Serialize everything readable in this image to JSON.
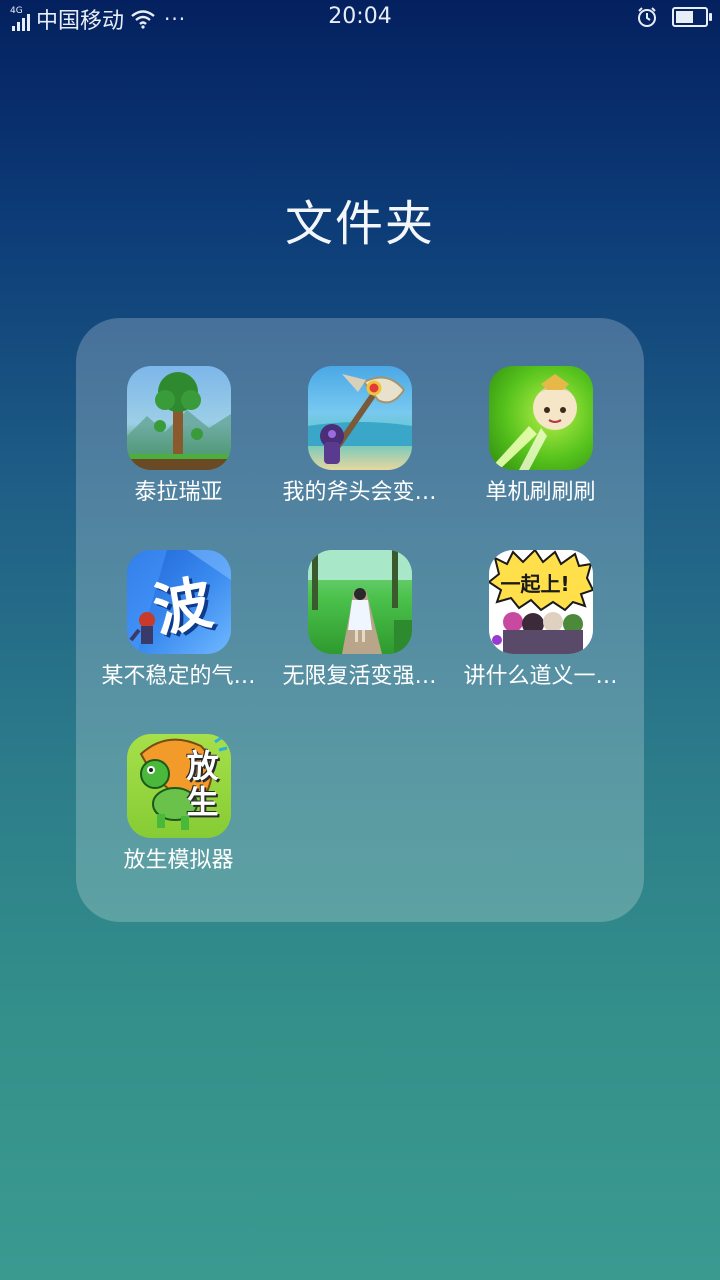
{
  "status_bar": {
    "network": "4G",
    "carrier": "中国移动",
    "more": "···",
    "time": "20:04",
    "battery_level": 0.62
  },
  "folder": {
    "title": "文件夹",
    "apps": [
      {
        "label": "泰拉瑞亚",
        "icon": "terraria-tree-icon"
      },
      {
        "label": "我的斧头会变…",
        "icon": "axe-icon"
      },
      {
        "label": "单机刷刷刷",
        "icon": "hero-sword-icon"
      },
      {
        "label": "某不稳定的气…",
        "icon": "wave-character-icon",
        "icon_text": "波"
      },
      {
        "label": "无限复活变强…",
        "icon": "forest-path-girl-icon"
      },
      {
        "label": "讲什么道义一…",
        "icon": "heroes-group-icon",
        "icon_text": "一起上!"
      },
      {
        "label": "放生模拟器",
        "icon": "turtle-icon",
        "icon_text": "放生"
      }
    ]
  },
  "colors": {
    "panel": "rgba(255,255,255,0.22)",
    "bg_top": "#04205f",
    "bg_bottom": "#3a9a90"
  }
}
